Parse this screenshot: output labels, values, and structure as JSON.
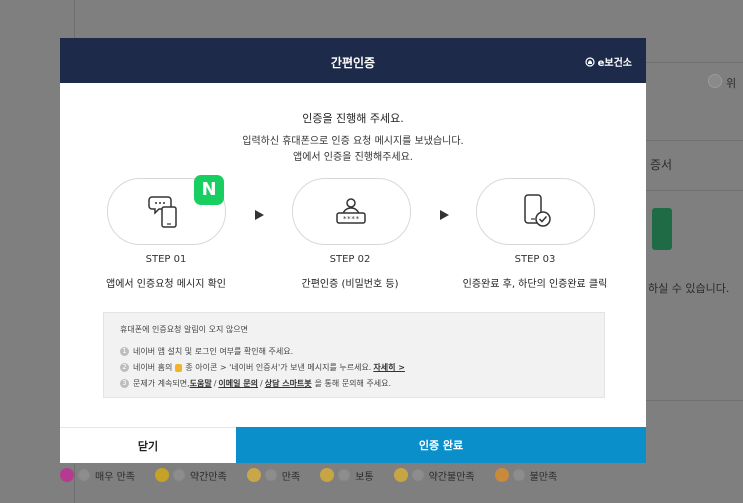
{
  "modal": {
    "title": "간편인증",
    "logo": "e보건소",
    "intro_main": "인증을 진행해 주세요.",
    "intro_line1": "입력하신 휴대폰으로 인증 요청 메시지를 보냈습니다.",
    "intro_line2": "앱에서 인증을 진행해주세요.",
    "badge_letter": "N",
    "steps": [
      {
        "label": "STEP 01",
        "desc": "앱에서 인증요청 메시지 확인",
        "icon": "chat-phone-icon"
      },
      {
        "label": "STEP 02",
        "desc": "간편인증 (비밀번호 등)",
        "icon": "user-password-icon"
      },
      {
        "label": "STEP 03",
        "desc": "인증완료 후, 하단의 인증완료 클릭",
        "icon": "phone-check-icon"
      }
    ],
    "notice": {
      "title": "휴대폰에 인증요청 알림이 오지 않으면",
      "item1": "네이버 앱 설치 및 로그인 여부를 확인해 주세요.",
      "item2_pre": "네이버 홈의",
      "item2_mid": "종 아이콘 > '네이버 인증서'가 보낸 메시지를 누르세요.",
      "item2_link": "자세히 >",
      "item3_pre": "문제가 계속되면,",
      "item3_link1": "도움말",
      "item3_link2": "이메일 문의",
      "item3_link3": "상담 스마트봇",
      "item3_post": "을 통해 문의해 주세요.",
      "sep": "/"
    },
    "close_label": "닫기",
    "done_label": "인증 완료"
  },
  "background": {
    "text_cert": "증서",
    "text_desc": "하실 수 있습니다.",
    "text_top_right": "위",
    "ratings": [
      "매우 만족",
      "약간만족",
      "만족",
      "보통",
      "약간불만족",
      "불만족"
    ]
  },
  "colors": {
    "header": "#1d2a49",
    "primary": "#0b8fcb",
    "naver": "#19ce60"
  }
}
